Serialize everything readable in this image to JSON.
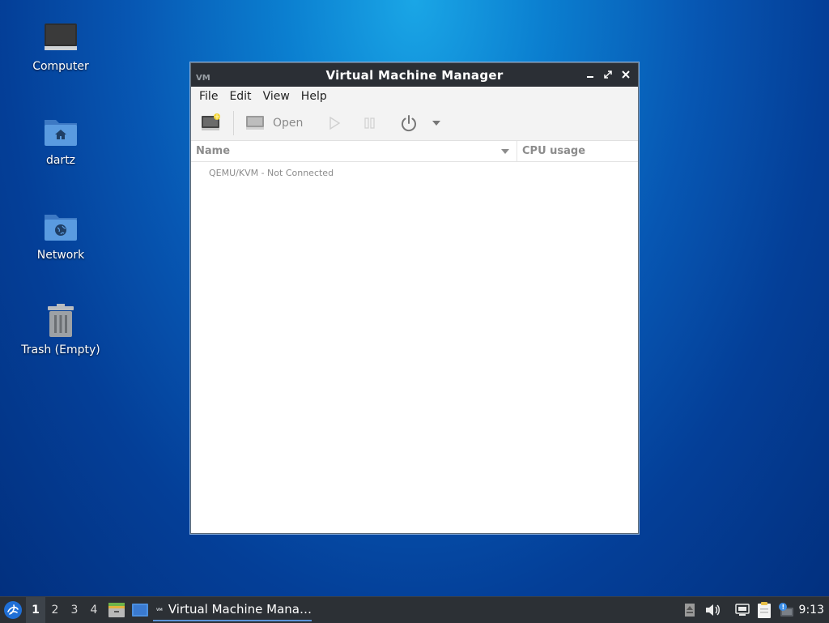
{
  "desktop": {
    "icons": [
      {
        "label": "Computer"
      },
      {
        "label": "dartz"
      },
      {
        "label": "Network"
      },
      {
        "label": "Trash (Empty)"
      }
    ]
  },
  "window": {
    "title": "Virtual Machine Manager",
    "menu": [
      "File",
      "Edit",
      "View",
      "Help"
    ],
    "toolbar": {
      "open_label": "Open"
    },
    "columns": {
      "name": "Name",
      "cpu": "CPU usage"
    },
    "rows": [
      {
        "label": "QEMU/KVM - Not Connected"
      }
    ]
  },
  "taskbar": {
    "workspaces": [
      "1",
      "2",
      "3",
      "4"
    ],
    "active_workspace": "1",
    "task_label": "Virtual Machine Mana…",
    "clock": "9:13"
  },
  "colors": {
    "titlebar": "#2b2f35",
    "accent": "#5b92d6",
    "taskbar": "#2c3035"
  }
}
